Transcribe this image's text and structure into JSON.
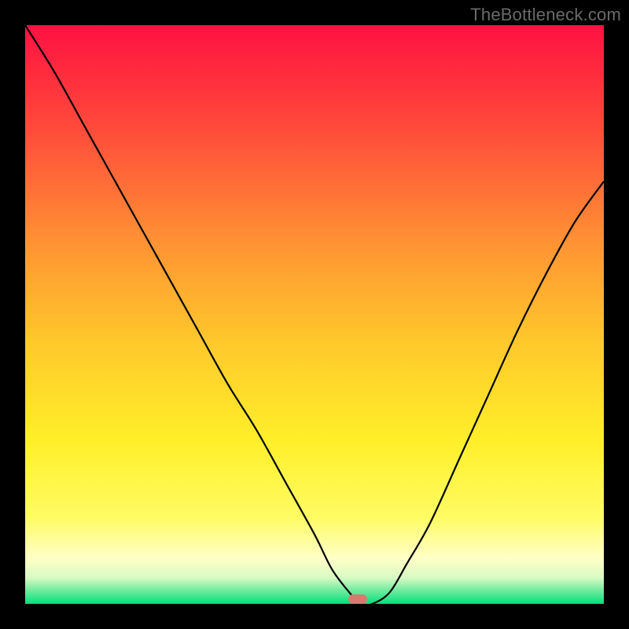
{
  "watermark": {
    "text": "TheBottleneck.com"
  },
  "chart_data": {
    "type": "line",
    "title": "",
    "xlabel": "",
    "ylabel": "",
    "xlim": [
      0,
      100
    ],
    "ylim": [
      0,
      100
    ],
    "grid": false,
    "legend": false,
    "annotations": [],
    "background_gradient_stops": [
      {
        "pos": 0.0,
        "color": "#ff1141"
      },
      {
        "pos": 0.18,
        "color": "#ff4b3b"
      },
      {
        "pos": 0.38,
        "color": "#ff9433"
      },
      {
        "pos": 0.55,
        "color": "#ffc92b"
      },
      {
        "pos": 0.72,
        "color": "#ffef2a"
      },
      {
        "pos": 0.85,
        "color": "#fffc63"
      },
      {
        "pos": 0.92,
        "color": "#ffffc6"
      },
      {
        "pos": 0.955,
        "color": "#d8fbc4"
      },
      {
        "pos": 0.975,
        "color": "#79eca1"
      },
      {
        "pos": 1.0,
        "color": "#03e07b"
      }
    ],
    "series": [
      {
        "name": "bottleneck-curve",
        "color": "#000000",
        "x": [
          0,
          5,
          10,
          15,
          20,
          25,
          30,
          35,
          40,
          45,
          50,
          53,
          56,
          58,
          60,
          63,
          66,
          70,
          75,
          80,
          85,
          90,
          95,
          100
        ],
        "values": [
          100,
          92,
          83,
          74,
          65,
          56,
          47,
          38,
          30,
          21,
          12,
          6,
          2,
          0,
          0,
          2,
          7,
          14,
          25,
          36,
          47,
          57,
          66,
          73
        ]
      }
    ],
    "marker": {
      "name": "optimum-marker",
      "shape": "pill",
      "color": "#d87a6e",
      "x": 57.5,
      "y": 0,
      "width_pct": 3.2,
      "height_pct": 1.6
    }
  }
}
